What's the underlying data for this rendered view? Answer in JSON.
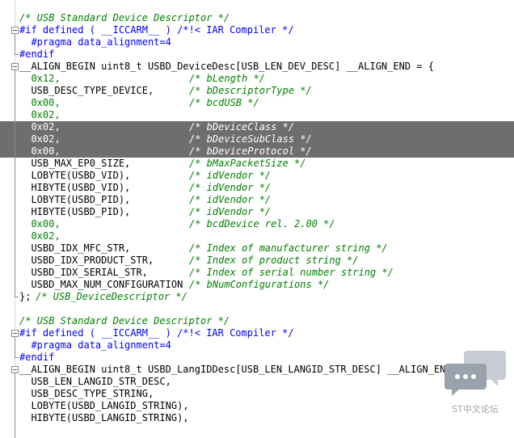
{
  "lines": [
    {
      "code": "",
      "comment": "/* USB Standard Device Descriptor */",
      "commentIndent": 0,
      "type": "comment"
    },
    {
      "code": "#if defined ( __ICCARM__ ) /*!< IAR Compiler */",
      "type": "pp-if"
    },
    {
      "code": "  #pragma data_alignment=4",
      "type": "pragma"
    },
    {
      "code": "#endif",
      "type": "pp"
    },
    {
      "code": "__ALIGN_BEGIN uint8_t USBD_DeviceDesc[USB_LEN_DEV_DESC] __ALIGN_END = {",
      "type": "decl"
    },
    {
      "code": "  0x12,",
      "comment": "/* bLength */",
      "type": "num"
    },
    {
      "code": "  USB_DESC_TYPE_DEVICE,",
      "comment": "/* bDescriptorType */",
      "type": "plain"
    },
    {
      "code": "  0x00,",
      "comment": "/* bcdUSB */",
      "type": "num"
    },
    {
      "code": "  0x02,",
      "type": "num"
    },
    {
      "code": "  0x02,",
      "comment": "/* bDeviceClass */",
      "type": "num-sel"
    },
    {
      "code": "  0x02,",
      "comment": "/* bDeviceSubClass */",
      "type": "num-sel"
    },
    {
      "code": "  0x00,",
      "comment": "/* bDeviceProtocol */",
      "type": "num-sel"
    },
    {
      "code": "  USB_MAX_EP0_SIZE,",
      "comment": "/* bMaxPacketSize */",
      "type": "plain"
    },
    {
      "code": "  LOBYTE(USBD_VID),",
      "comment": "/* idVendor */",
      "type": "plain"
    },
    {
      "code": "  HIBYTE(USBD_VID),",
      "comment": "/* idVendor */",
      "type": "plain"
    },
    {
      "code": "  LOBYTE(USBD_PID),",
      "comment": "/* idVendor */",
      "type": "plain"
    },
    {
      "code": "  HIBYTE(USBD_PID),",
      "comment": "/* idVendor */",
      "type": "plain"
    },
    {
      "code": "  0x00,",
      "comment": "/* bcdDevice rel. 2.00 */",
      "type": "num"
    },
    {
      "code": "  0x02,",
      "type": "num"
    },
    {
      "code": "  USBD_IDX_MFC_STR,",
      "comment": "/* Index of manufacturer string */",
      "type": "plain"
    },
    {
      "code": "  USBD_IDX_PRODUCT_STR,",
      "comment": "/* Index of product string */",
      "type": "plain"
    },
    {
      "code": "  USBD_IDX_SERIAL_STR,",
      "comment": "/* Index of serial number string */",
      "type": "plain"
    },
    {
      "code": "  USBD_MAX_NUM_CONFIGURATION",
      "comment": "/* bNumConfigurations */",
      "type": "plain"
    },
    {
      "code": "}; ",
      "comment": "/* USB_DeviceDescriptor */",
      "type": "close"
    },
    {
      "code": "",
      "type": "blank"
    },
    {
      "code": "",
      "comment": "/* USB Standard Device Descriptor */",
      "type": "comment"
    },
    {
      "code": "#if defined ( __ICCARM__ ) /*!< IAR Compiler */",
      "type": "pp-if"
    },
    {
      "code": "  #pragma data_alignment=4",
      "type": "pragma"
    },
    {
      "code": "#endif",
      "type": "pp"
    },
    {
      "code": "__ALIGN_BEGIN uint8_t USBD_LangIDDesc[USB_LEN_LANGID_STR_DESC] __ALIGN_END = {",
      "type": "decl"
    },
    {
      "code": "  USB_LEN_LANGID_STR_DESC,",
      "type": "plain"
    },
    {
      "code": "  USB_DESC_TYPE_STRING,",
      "type": "plain"
    },
    {
      "code": "  LOBYTE(USBD_LANGID_STRING),",
      "type": "plain"
    },
    {
      "code": "  HIBYTE(USBD_LANGID_STRING),",
      "type": "plain"
    }
  ],
  "watermark": {
    "text": "ST中文论坛"
  },
  "colors": {
    "comment": "#008000",
    "preprocessor": "#0000ff",
    "number": "#008000",
    "selection": "#6e6e6e"
  }
}
